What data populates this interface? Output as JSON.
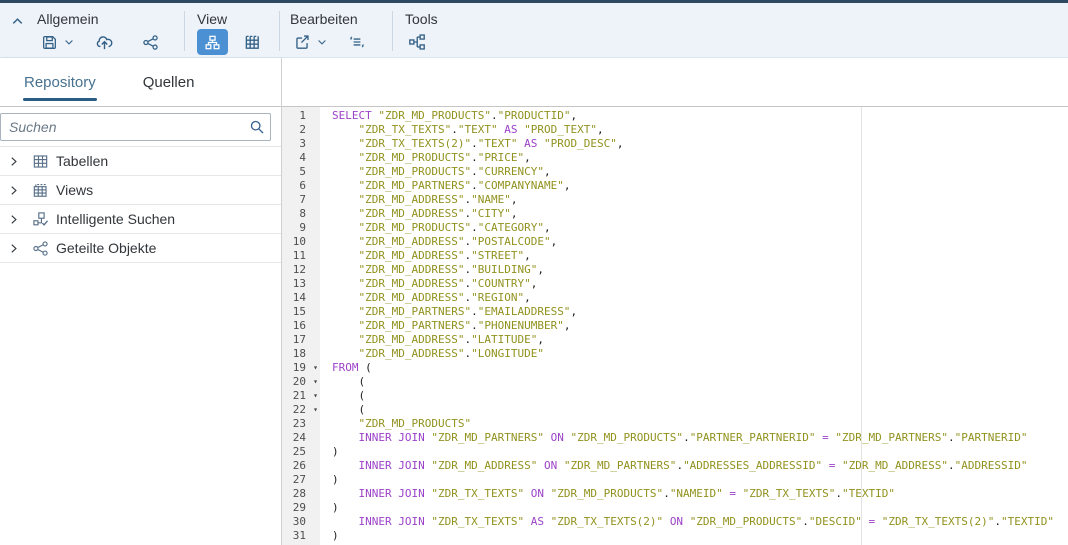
{
  "toolbar": {
    "groups": [
      {
        "label": "Allgemein",
        "buttons": [
          "save-icon",
          "save-menu-chevron-icon",
          "deploy-upload-icon",
          "share-icon"
        ]
      },
      {
        "label": "View",
        "buttons": [
          "diagram-view-icon",
          "data-preview-grid-icon"
        ],
        "selected": "diagram-view-icon"
      },
      {
        "label": "Bearbeiten",
        "buttons": [
          "export-icon",
          "export-menu-chevron-icon",
          "edit-statements-icon"
        ]
      },
      {
        "label": "Tools",
        "buttons": [
          "join-combine-icon"
        ]
      }
    ]
  },
  "sidebar": {
    "tabs": [
      {
        "label": "Repository",
        "active": true
      },
      {
        "label": "Quellen",
        "active": false
      }
    ],
    "search": {
      "placeholder": "Suchen",
      "icon": "search-icon"
    },
    "tree": [
      {
        "label": "Tabellen",
        "icon": "table-icon"
      },
      {
        "label": "Views",
        "icon": "views-icon"
      },
      {
        "label": "Intelligente Suchen",
        "icon": "smart-search-icon"
      },
      {
        "label": "Geteilte Objekte",
        "icon": "share-icon"
      }
    ]
  },
  "editor": {
    "language": "SQL",
    "fold_lines": [
      19,
      20,
      21,
      22
    ],
    "lines": [
      "SELECT \"ZDR_MD_PRODUCTS\".\"PRODUCTID\",",
      "    \"ZDR_TX_TEXTS\".\"TEXT\" AS \"PROD_TEXT\",",
      "    \"ZDR_TX_TEXTS(2)\".\"TEXT\" AS \"PROD_DESC\",",
      "    \"ZDR_MD_PRODUCTS\".\"PRICE\",",
      "    \"ZDR_MD_PRODUCTS\".\"CURRENCY\",",
      "    \"ZDR_MD_PARTNERS\".\"COMPANYNAME\",",
      "    \"ZDR_MD_ADDRESS\".\"NAME\",",
      "    \"ZDR_MD_ADDRESS\".\"CITY\",",
      "    \"ZDR_MD_PRODUCTS\".\"CATEGORY\",",
      "    \"ZDR_MD_ADDRESS\".\"POSTALCODE\",",
      "    \"ZDR_MD_ADDRESS\".\"STREET\",",
      "    \"ZDR_MD_ADDRESS\".\"BUILDING\",",
      "    \"ZDR_MD_ADDRESS\".\"COUNTRY\",",
      "    \"ZDR_MD_ADDRESS\".\"REGION\",",
      "    \"ZDR_MD_PARTNERS\".\"EMAILADDRESS\",",
      "    \"ZDR_MD_PARTNERS\".\"PHONENUMBER\",",
      "    \"ZDR_MD_ADDRESS\".\"LATITUDE\",",
      "    \"ZDR_MD_ADDRESS\".\"LONGITUDE\"",
      "FROM (",
      "    (",
      "    (",
      "    (",
      "    \"ZDR_MD_PRODUCTS\"",
      "    INNER JOIN \"ZDR_MD_PARTNERS\" ON \"ZDR_MD_PRODUCTS\".\"PARTNER_PARTNERID\" = \"ZDR_MD_PARTNERS\".\"PARTNERID\"",
      ")",
      "    INNER JOIN \"ZDR_MD_ADDRESS\" ON \"ZDR_MD_PARTNERS\".\"ADDRESSES_ADDRESSID\" = \"ZDR_MD_ADDRESS\".\"ADDRESSID\"",
      ")",
      "    INNER JOIN \"ZDR_TX_TEXTS\" ON \"ZDR_MD_PRODUCTS\".\"NAMEID\" = \"ZDR_TX_TEXTS\".\"TEXTID\"",
      ")",
      "    INNER JOIN \"ZDR_TX_TEXTS\" AS \"ZDR_TX_TEXTS(2)\" ON \"ZDR_MD_PRODUCTS\".\"DESCID\" = \"ZDR_TX_TEXTS(2)\".\"TEXTID\"",
      ")"
    ]
  },
  "colors": {
    "top_strip": "#2d4a62",
    "toolbar_bg": "#edf3f9",
    "selected_button": "#4a90d2",
    "tab_underline": "#2a5c85",
    "sql_keyword": "#9c42c8",
    "sql_string": "#91921e"
  }
}
